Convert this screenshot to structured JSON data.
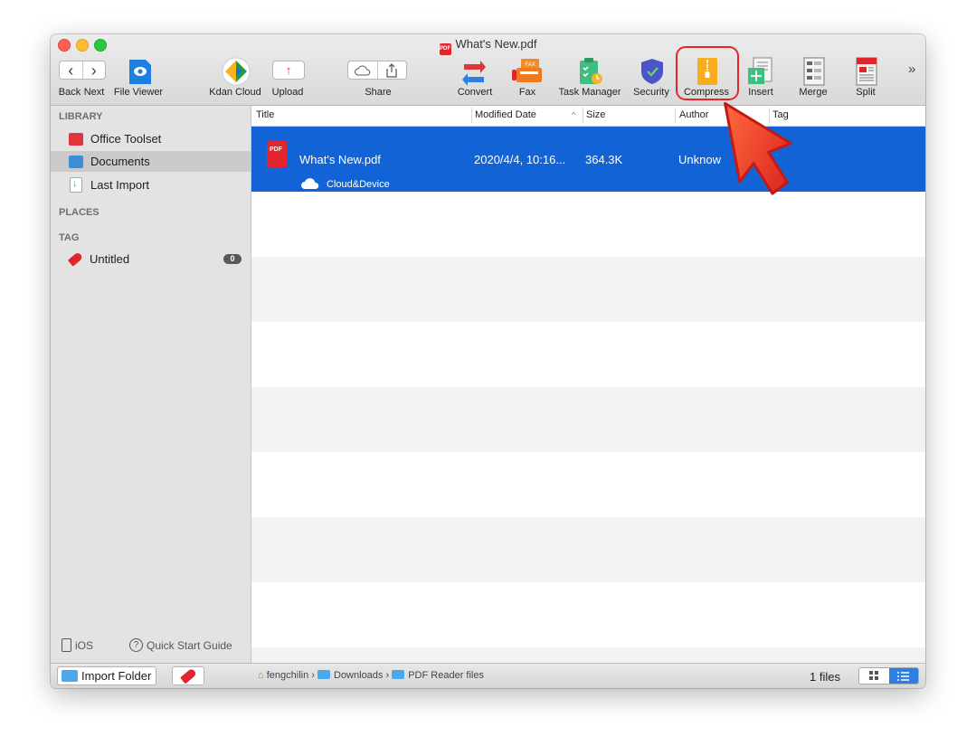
{
  "window": {
    "title": "What's New.pdf"
  },
  "toolbar": {
    "back_label": "Back",
    "next_label": "Next",
    "file_viewer_label": "File Viewer",
    "kdan_cloud_label": "Kdan Cloud",
    "upload_label": "Upload",
    "share_label": "Share",
    "convert_label": "Convert",
    "fax_label": "Fax",
    "fax_icon_text": "FAX",
    "task_manager_label": "Task Manager",
    "security_label": "Security",
    "compress_label": "Compress",
    "insert_label": "Insert",
    "merge_label": "Merge",
    "split_label": "Split",
    "overflow_icon": "»",
    "back_icon": "‹",
    "next_icon": "›"
  },
  "sidebar": {
    "library_heading": "LIBRARY",
    "items": [
      {
        "label": "Office Toolset",
        "icon": "toolbox-icon",
        "color": "#e0353b"
      },
      {
        "label": "Documents",
        "icon": "inbox-icon",
        "color": "#3a8fd8"
      },
      {
        "label": "Last Import",
        "icon": "import-icon",
        "color": "#3fae49"
      }
    ],
    "places_heading": "PLACES",
    "tag_heading": "TAG",
    "tags": [
      {
        "label": "Untitled",
        "count": "0"
      }
    ],
    "ios_label": "iOS",
    "quick_start_label": "Quick Start Guide",
    "import_folder_label": "Import Folder"
  },
  "table": {
    "columns": {
      "title": "Title",
      "modified": "Modified Date",
      "sort_indicator": "^",
      "size": "Size",
      "author": "Author",
      "tag": "Tag"
    },
    "rows": [
      {
        "title": "What's New.pdf",
        "modified": "2020/4/4, 10:16...",
        "size": "364.3K",
        "author": "Unknow",
        "location": "Cloud&Device",
        "badge": "PDF"
      }
    ]
  },
  "statusbar": {
    "breadcrumb": [
      "fengchilin",
      "Downloads",
      "PDF Reader files"
    ],
    "separator": "›",
    "file_count": "1 files"
  },
  "colors": {
    "selection": "#1264d6",
    "highlight_ring": "#e8252b",
    "pdf_red": "#e2242c"
  }
}
